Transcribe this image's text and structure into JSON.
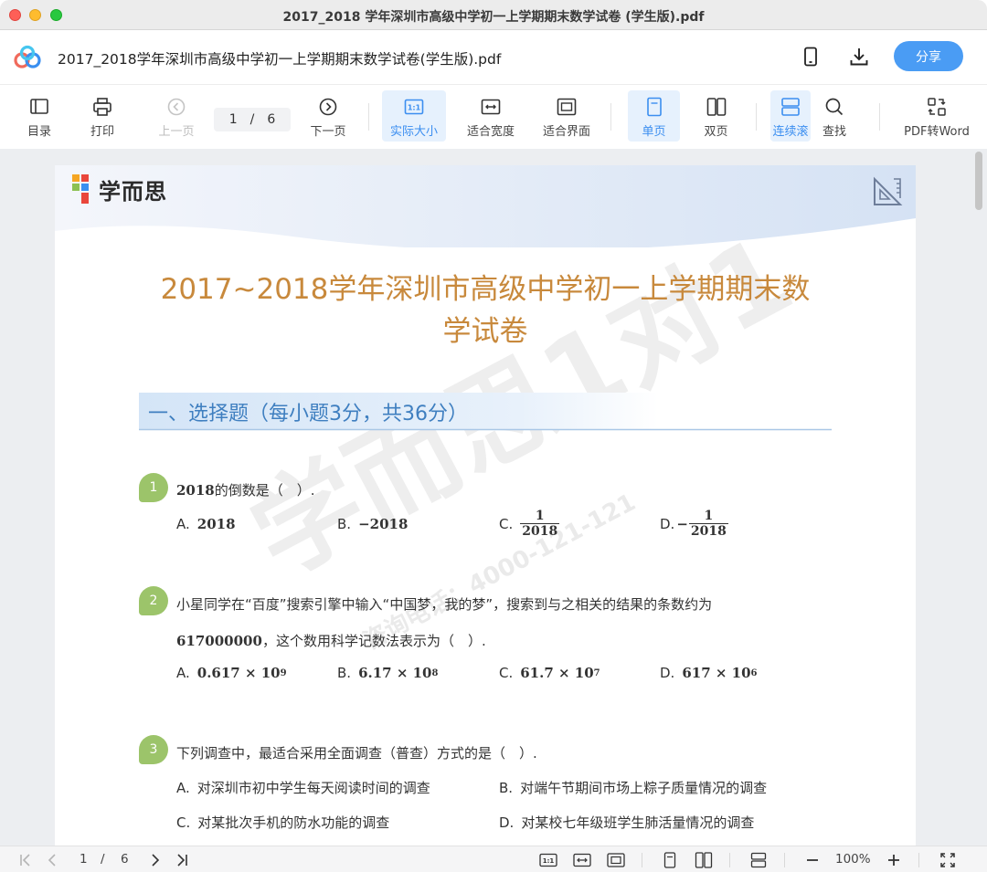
{
  "window": {
    "title": "2017_2018 学年深圳市高级中学初一上学期期末数学试卷 (学生版).pdf"
  },
  "header": {
    "doc_name": "2017_2018学年深圳市高级中学初一上学期期末数学试卷(学生版).pdf",
    "share_label": "分享",
    "icons": [
      "app-logo-icon",
      "mobile-icon",
      "download-icon"
    ]
  },
  "toolbar": {
    "toc": "目录",
    "print": "打印",
    "prev": "上一页",
    "page_current": "1",
    "page_sep": "/",
    "page_total": "6",
    "next": "下一页",
    "actual_size": "实际大小",
    "fit_width": "适合宽度",
    "fit_page": "适合界面",
    "single": "单页",
    "double": "双页",
    "continuous": "连续滚",
    "find": "查找",
    "pdf_word": "PDF转Word"
  },
  "document": {
    "brand": "学而思",
    "title_line1": "2017~2018学年深圳市高级中学初一上学期期末数",
    "title_line2": "学试卷",
    "section": "一、选择题（每小题3分，共36分）",
    "watermark": "学而思1对1",
    "watermark_sub": "咨询电话：4000-121-121",
    "questions": [
      {
        "num": "1",
        "text_math": "2018",
        "text": "的倒数是（　）.",
        "options": [
          {
            "label": "A.",
            "value": "2018"
          },
          {
            "label": "B.",
            "value": "−2018"
          },
          {
            "label": "C.",
            "num": "1",
            "den": "2018"
          },
          {
            "label": "D.",
            "sign": "−",
            "num": "1",
            "den": "2018"
          }
        ]
      },
      {
        "num": "2",
        "text": "小星同学在“百度”搜索引擎中输入“中国梦，我的梦”，搜索到与之相关的结果的条数约为",
        "text2_math": "617000000",
        "text2": "，这个数用科学记数法表示为（　）.",
        "options": [
          {
            "label": "A.",
            "mant": "0.617 × 10",
            "exp": "9"
          },
          {
            "label": "B.",
            "mant": "6.17 × 10",
            "exp": "8"
          },
          {
            "label": "C.",
            "mant": "61.7 × 10",
            "exp": "7"
          },
          {
            "label": "D.",
            "mant": "617 × 10",
            "exp": "6"
          }
        ]
      },
      {
        "num": "3",
        "text": "下列调查中，最适合采用全面调查（普查）方式的是（　）.",
        "options": [
          {
            "label": "A.",
            "value": "对深圳市初中学生每天阅读时间的调查"
          },
          {
            "label": "B.",
            "value": "对端午节期间市场上粽子质量情况的调查"
          },
          {
            "label": "C.",
            "value": "对某批次手机的防水功能的调查"
          },
          {
            "label": "D.",
            "value": "对某校七年级班学生肺活量情况的调查"
          }
        ]
      }
    ]
  },
  "statusbar": {
    "page_current": "1",
    "page_sep": "/",
    "page_total": "6",
    "zoom": "100%"
  },
  "colors": {
    "accent": "#4a9cf4",
    "title": "#c8893c",
    "section": "#3f7fc0",
    "question_badge": "#9cc46a"
  }
}
